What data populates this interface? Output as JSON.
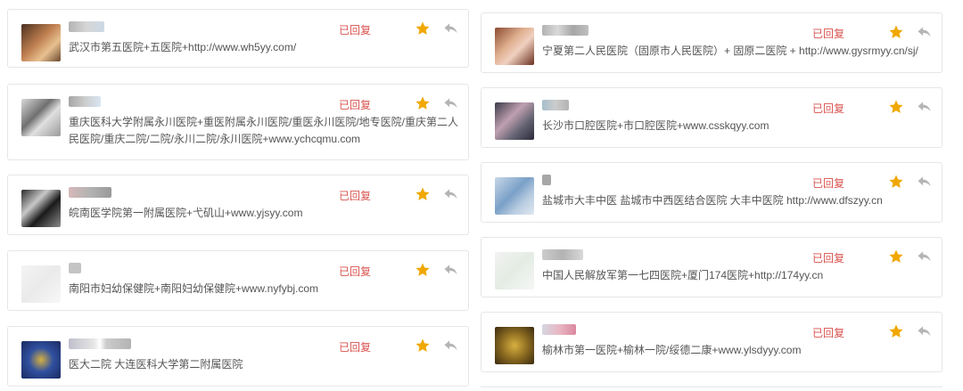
{
  "status_label": "已回复",
  "icons": {
    "star": "star-icon",
    "reply": "reply-icon"
  },
  "colors": {
    "status": "#d9534f",
    "star": "#f0a800",
    "reply": "#b5b5b5"
  },
  "left_messages": [
    {
      "text": "武汉市第五医院+五医院+http://www.wh5yy.com/"
    },
    {
      "text": "重庆医科大学附属永川医院+重医附属永川医院/重医永川医院/地专医院/重庆第二人民医院/重庆二院/二院/永川二院/永川医院+www.ychcqmu.com"
    },
    {
      "text": "皖南医学院第一附属医院+弋矶山+www.yjsyy.com"
    },
    {
      "text": "南阳市妇幼保健院+南阳妇幼保健院+www.nyfybj.com"
    },
    {
      "text": "医大二院 大连医科大学第二附属医院"
    }
  ],
  "right_messages": [
    {
      "text": "宁夏第二人民医院（固原市人民医院）+ 固原二医院 + http://www.gysrmyy.cn/sj/"
    },
    {
      "text": "长沙市口腔医院+市口腔医院+www.csskqyy.com"
    },
    {
      "text": "盐城市大丰中医 盐城市中西医结合医院 大丰中医院 http://www.dfszyy.cn"
    },
    {
      "text": "中国人民解放军第一七四医院+厦门174医院+http://174yy.cn"
    },
    {
      "text": "榆林市第一医院+榆林一院/绥德二康+www.ylsdyyy.com"
    }
  ]
}
